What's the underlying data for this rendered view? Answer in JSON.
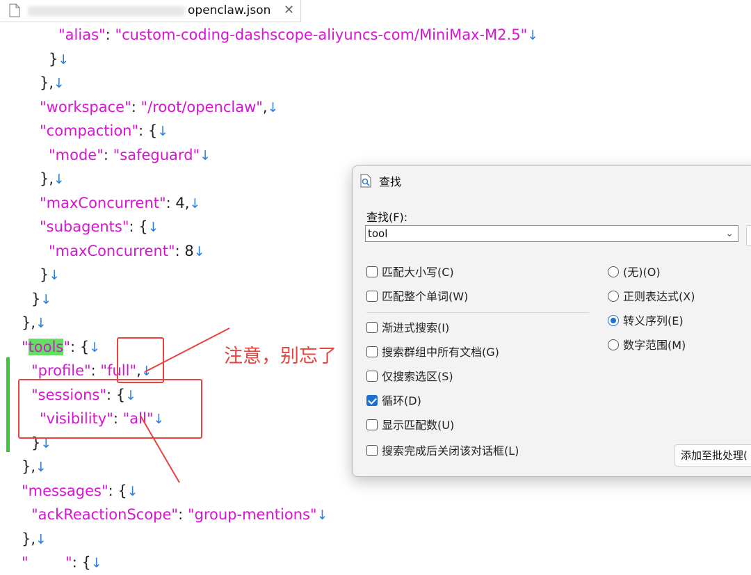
{
  "tab": {
    "title": "openclaw.json",
    "close": "✕",
    "file_icon": "file-icon"
  },
  "code_lines": [
    {
      "indent": 84,
      "parts": [
        [
          "s",
          "\"alias\""
        ],
        [
          "p",
          ": "
        ],
        [
          "s",
          "\"custom-coding-dashscope-aliyuncs-com/MiniMax-M2.5\""
        ],
        [
          "e",
          "↓"
        ]
      ]
    },
    {
      "indent": 70,
      "parts": [
        [
          "p",
          "}"
        ],
        [
          "e",
          "↓"
        ]
      ]
    },
    {
      "indent": 57,
      "parts": [
        [
          "p",
          "},"
        ],
        [
          "e",
          "↓"
        ]
      ]
    },
    {
      "indent": 57,
      "parts": [
        [
          "k",
          "\"workspace\""
        ],
        [
          "p",
          ": "
        ],
        [
          "s",
          "\"/root/openclaw\""
        ],
        [
          "p",
          ","
        ],
        [
          "e",
          "↓"
        ]
      ]
    },
    {
      "indent": 57,
      "parts": [
        [
          "k",
          "\"compaction\""
        ],
        [
          "p",
          ": {"
        ],
        [
          "e",
          "↓"
        ]
      ]
    },
    {
      "indent": 70,
      "parts": [
        [
          "k",
          "\"mode\""
        ],
        [
          "p",
          ": "
        ],
        [
          "s",
          "\"safeguard\""
        ],
        [
          "e",
          "↓"
        ]
      ]
    },
    {
      "indent": 57,
      "parts": [
        [
          "p",
          "},"
        ],
        [
          "e",
          "↓"
        ]
      ]
    },
    {
      "indent": 57,
      "parts": [
        [
          "k",
          "\"maxConcurrent\""
        ],
        [
          "p",
          ": 4,"
        ],
        [
          "e",
          "↓"
        ]
      ]
    },
    {
      "indent": 57,
      "parts": [
        [
          "k",
          "\"subagents\""
        ],
        [
          "p",
          ": {"
        ],
        [
          "e",
          "↓"
        ]
      ]
    },
    {
      "indent": 70,
      "parts": [
        [
          "k",
          "\"maxConcurrent\""
        ],
        [
          "p",
          ": 8"
        ],
        [
          "e",
          "↓"
        ]
      ]
    },
    {
      "indent": 57,
      "parts": [
        [
          "p",
          "}"
        ],
        [
          "e",
          "↓"
        ]
      ]
    },
    {
      "indent": 45,
      "parts": [
        [
          "p",
          "}"
        ],
        [
          "e",
          "↓"
        ]
      ]
    },
    {
      "indent": 31,
      "parts": [
        [
          "p",
          "},"
        ],
        [
          "e",
          "↓"
        ]
      ]
    },
    {
      "indent": 31,
      "parts": [
        [
          "k",
          "\""
        ],
        [
          "h",
          "tools"
        ],
        [
          "k",
          "\""
        ],
        [
          "p",
          ": {"
        ],
        [
          "e",
          "↓"
        ]
      ]
    },
    {
      "indent": 45,
      "parts": [
        [
          "k",
          "\"profile\""
        ],
        [
          "p",
          ": "
        ],
        [
          "s",
          "\"full\""
        ],
        [
          "p",
          ","
        ],
        [
          "e",
          "↓"
        ]
      ]
    },
    {
      "indent": 45,
      "parts": [
        [
          "k",
          "\"sessions\""
        ],
        [
          "p",
          ": {"
        ],
        [
          "e",
          "↓"
        ]
      ]
    },
    {
      "indent": 57,
      "parts": [
        [
          "k",
          "\"visibility\""
        ],
        [
          "p",
          ": "
        ],
        [
          "s",
          "\"all\""
        ],
        [
          "e",
          "↓"
        ]
      ]
    },
    {
      "indent": 45,
      "parts": [
        [
          "p",
          "}"
        ],
        [
          "e",
          "↓"
        ]
      ]
    },
    {
      "indent": 31,
      "parts": [
        [
          "p",
          "},"
        ],
        [
          "e",
          "↓"
        ]
      ]
    },
    {
      "indent": 31,
      "parts": [
        [
          "k",
          "\"messages\""
        ],
        [
          "p",
          ": {"
        ],
        [
          "e",
          "↓"
        ]
      ]
    },
    {
      "indent": 45,
      "parts": [
        [
          "k",
          "\"ackReactionScope\""
        ],
        [
          "p",
          ": "
        ],
        [
          "s",
          "\"group-mentions\""
        ],
        [
          "e",
          "↓"
        ]
      ]
    },
    {
      "indent": 31,
      "parts": [
        [
          "p",
          "},"
        ],
        [
          "e",
          "↓"
        ]
      ]
    },
    {
      "indent": 31,
      "parts": [
        [
          "k",
          "\"        \""
        ],
        [
          "p",
          ": {"
        ],
        [
          "e",
          "↓"
        ]
      ]
    }
  ],
  "annotation": {
    "text": "注意，别忘了",
    "color": "#e8433c"
  },
  "find_dialog": {
    "title": "查找",
    "find_label": "查找(F):",
    "search_value": "tool",
    "checkboxes": [
      {
        "label": "匹配大小写(C)",
        "checked": false
      },
      {
        "label": "匹配整个单词(W)",
        "checked": false
      },
      {
        "label": "渐进式搜索(I)",
        "checked": false
      },
      {
        "label": "搜索群组中所有文档(G)",
        "checked": false
      },
      {
        "label": "仅搜索选区(S)",
        "checked": false
      },
      {
        "label": "循环(D)",
        "checked": true
      },
      {
        "label": "显示匹配数(U)",
        "checked": false
      },
      {
        "label": "搜索完成后关闭该对话框(L)",
        "checked": false
      }
    ],
    "radios": [
      {
        "label": "(无)(O)",
        "checked": false
      },
      {
        "label": "正则表达式(X)",
        "checked": false
      },
      {
        "label": "转义序列(E)",
        "checked": true
      },
      {
        "label": "数字范围(M)",
        "checked": false
      }
    ],
    "batch_button": "添加至批处理("
  }
}
